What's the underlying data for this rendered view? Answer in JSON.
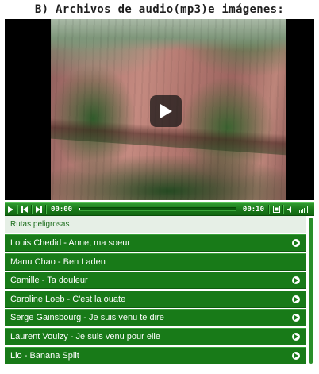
{
  "heading": "B) Archivos de audio(mp3)e imágenes:",
  "player": {
    "current_time": "00:00",
    "duration": "00:10",
    "progress": 0.0,
    "controls": [
      "play-icon",
      "prev-icon",
      "next-icon",
      "fullscreen-icon",
      "volume-icon"
    ]
  },
  "playlist": {
    "title": "Rutas peligrosas",
    "items": [
      {
        "label": "Louis Chedid - Anne, ma soeur",
        "has_arrow": true
      },
      {
        "label": "Manu Chao - Ben Laden",
        "has_arrow": false
      },
      {
        "label": "Camille - Ta douleur",
        "has_arrow": true
      },
      {
        "label": "Caroline Loeb - C'est la ouate",
        "has_arrow": true
      },
      {
        "label": "Serge Gainsbourg - Je suis venu te dire",
        "has_arrow": true
      },
      {
        "label": "Laurent Voulzy - Je suis venu pour elle",
        "has_arrow": true
      },
      {
        "label": "Lio - Banana Split",
        "has_arrow": true
      }
    ]
  },
  "colors": {
    "accent": "#187a18",
    "playlist_title_text": "#1f6f1f"
  }
}
